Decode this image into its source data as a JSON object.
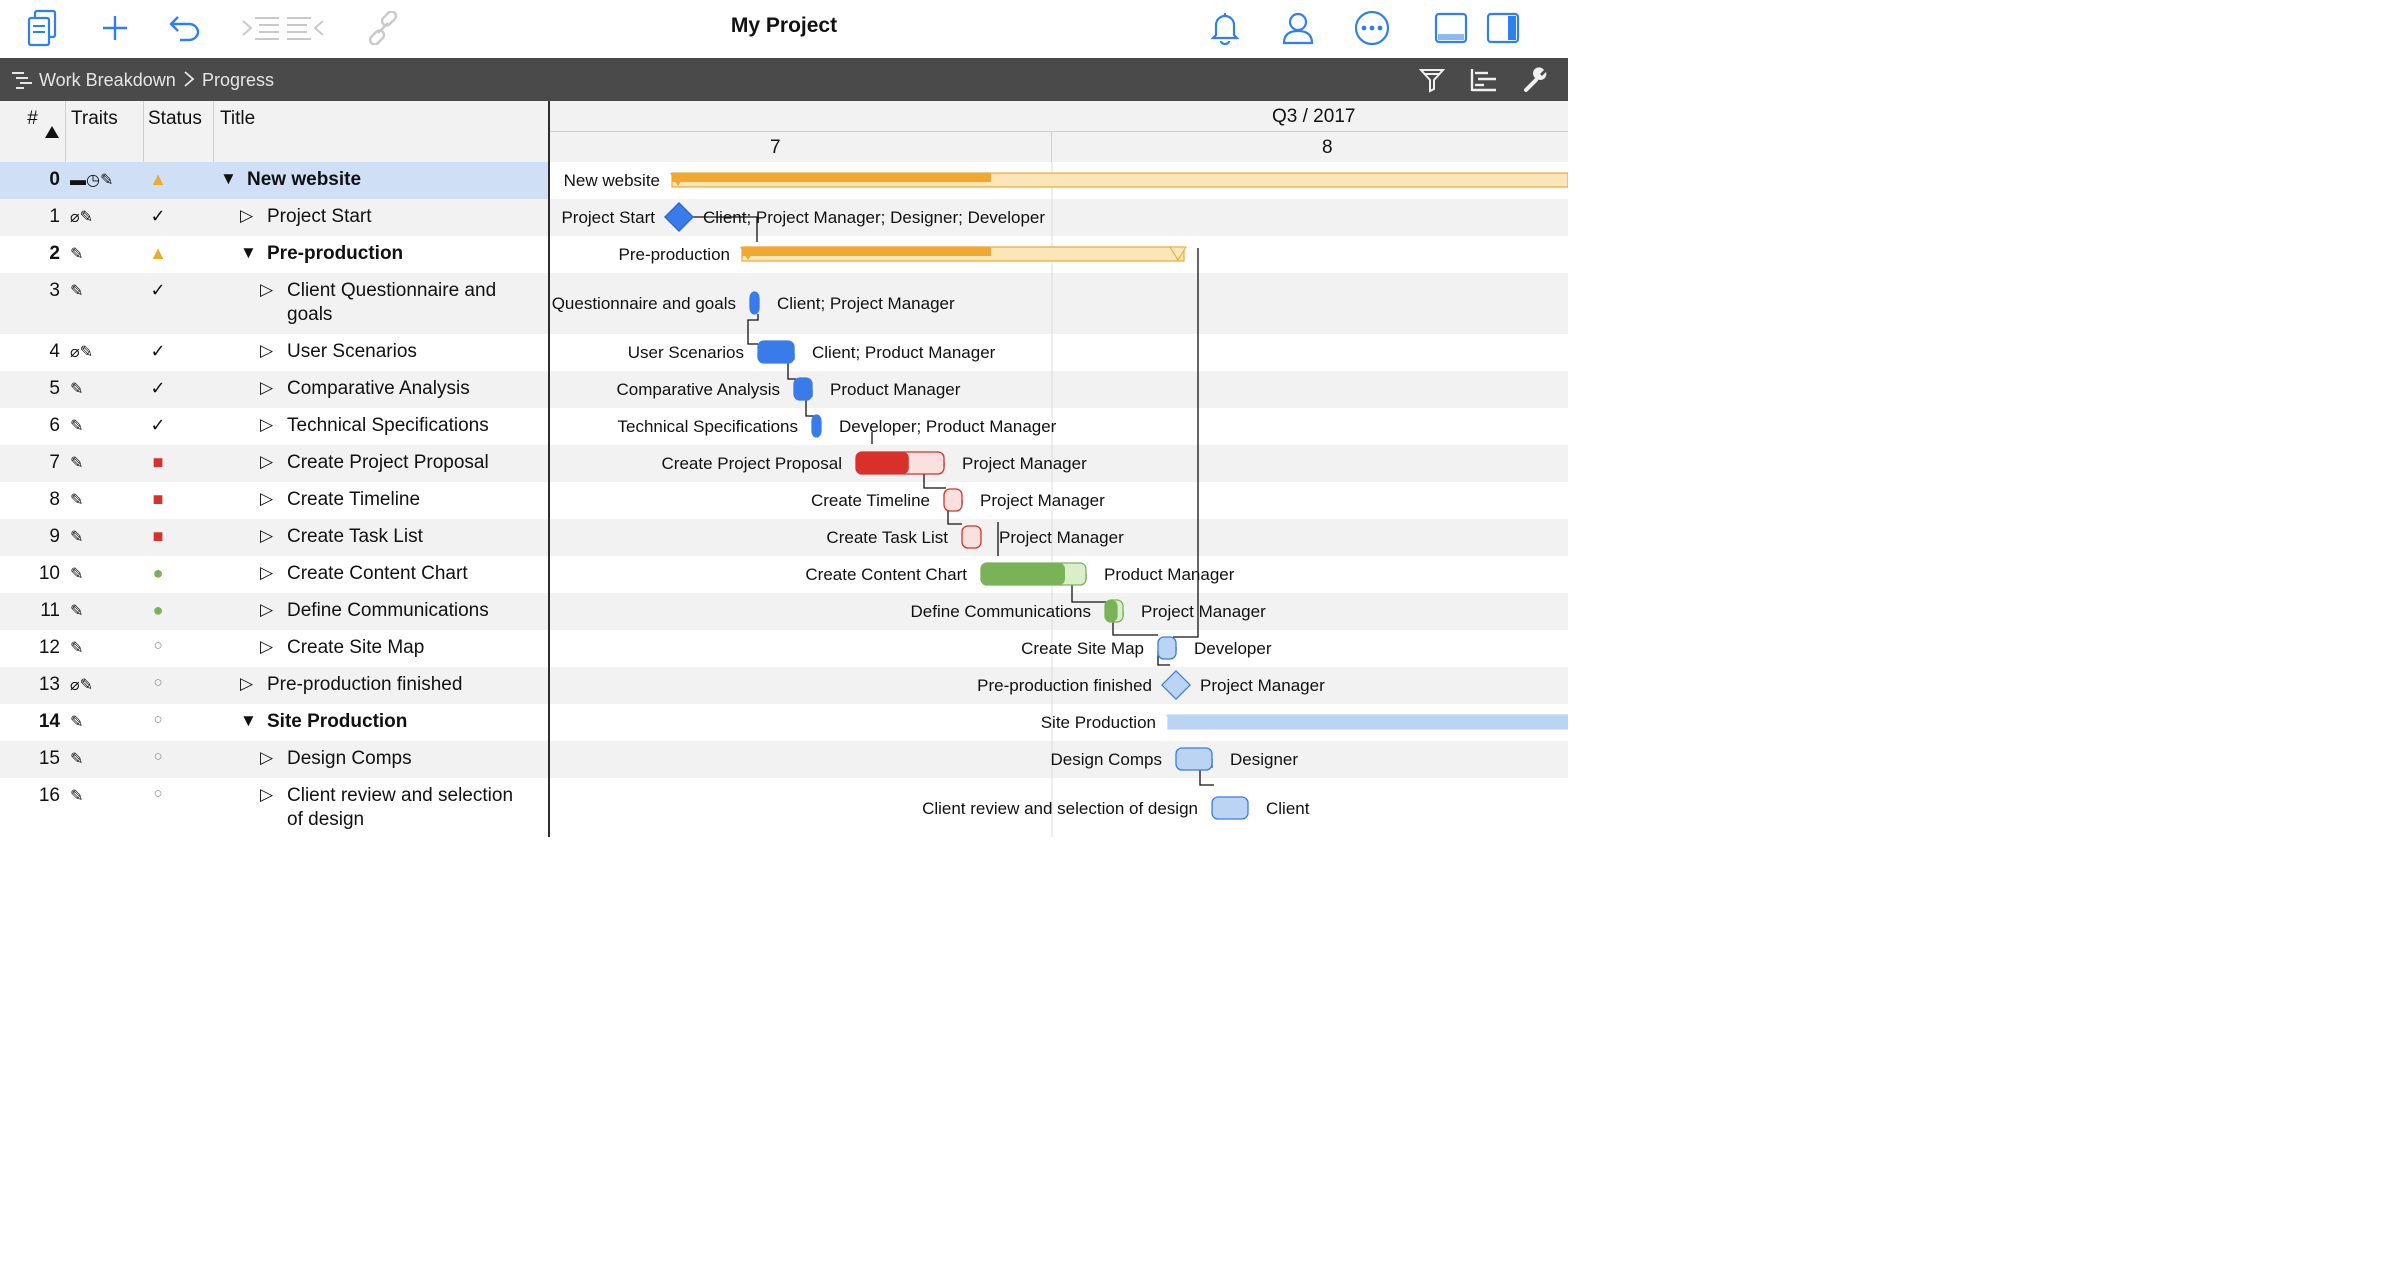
{
  "app": {
    "title": "My Project"
  },
  "breadcrumb": {
    "item1": "Work Breakdown",
    "item2": "Progress"
  },
  "columns": {
    "num": "#",
    "traits": "Traits",
    "status": "Status",
    "title": "Title"
  },
  "timeline": {
    "quarter": "Q3 / 2017",
    "weeks": [
      "7",
      "8"
    ]
  },
  "colors": {
    "complete_blue": "#3a7bec",
    "planned_blue": "#bcd4f4",
    "overdue_red": "#d8302a",
    "ontrack_green": "#7ab357",
    "group_orange": "#f0a830"
  },
  "rows": [
    {
      "num": "0",
      "traits": "▬◷✎",
      "status": "▲",
      "title": "New website",
      "indent": 0,
      "expander": "▼",
      "bold": true,
      "gantt_label": "New website",
      "resources": ""
    },
    {
      "num": "1",
      "traits": "⌀✎",
      "status": "✓",
      "title": "Project Start",
      "indent": 1,
      "expander": "▷",
      "bold": false,
      "gantt_label": "Project Start",
      "resources": "Client; Project Manager; Designer; Developer"
    },
    {
      "num": "2",
      "traits": "✎",
      "status": "▲",
      "title": "Pre-production",
      "indent": 1,
      "expander": "▼",
      "bold": true,
      "gantt_label": "Pre-production",
      "resources": ""
    },
    {
      "num": "3",
      "traits": "✎",
      "status": "✓",
      "title": "Client Questionnaire and",
      "title2": "goals",
      "indent": 2,
      "expander": "▷",
      "bold": false,
      "gantt_label": "Questionnaire and goals",
      "resources": "Client; Project Manager"
    },
    {
      "num": "4",
      "traits": "⌀✎",
      "status": "✓",
      "title": "User Scenarios",
      "indent": 2,
      "expander": "▷",
      "bold": false,
      "gantt_label": "User Scenarios",
      "resources": "Client; Product Manager"
    },
    {
      "num": "5",
      "traits": "✎",
      "status": "✓",
      "title": "Comparative Analysis",
      "indent": 2,
      "expander": "▷",
      "bold": false,
      "gantt_label": "Comparative Analysis",
      "resources": "Product Manager"
    },
    {
      "num": "6",
      "traits": "✎",
      "status": "✓",
      "title": "Technical Specifications",
      "indent": 2,
      "expander": "▷",
      "bold": false,
      "gantt_label": "Technical Specifications",
      "resources": "Developer; Product Manager"
    },
    {
      "num": "7",
      "traits": "✎",
      "status": "■",
      "title": "Create Project Proposal",
      "indent": 2,
      "expander": "▷",
      "bold": false,
      "gantt_label": "Create Project Proposal",
      "resources": "Project Manager"
    },
    {
      "num": "8",
      "traits": "✎",
      "status": "■",
      "title": "Create Timeline",
      "indent": 2,
      "expander": "▷",
      "bold": false,
      "gantt_label": "Create Timeline",
      "resources": "Project Manager"
    },
    {
      "num": "9",
      "traits": "✎",
      "status": "■",
      "title": "Create Task List",
      "indent": 2,
      "expander": "▷",
      "bold": false,
      "gantt_label": "Create Task List",
      "resources": "Project Manager"
    },
    {
      "num": "10",
      "traits": "✎",
      "status": "●",
      "title": "Create Content Chart",
      "indent": 2,
      "expander": "▷",
      "bold": false,
      "gantt_label": "Create Content Chart",
      "resources": "Product Manager"
    },
    {
      "num": "11",
      "traits": "✎",
      "status": "●",
      "title": "Define Communications",
      "indent": 2,
      "expander": "▷",
      "bold": false,
      "gantt_label": "Define Communications",
      "resources": "Project Manager"
    },
    {
      "num": "12",
      "traits": "✎",
      "status": "○",
      "title": "Create Site Map",
      "indent": 2,
      "expander": "▷",
      "bold": false,
      "gantt_label": "Create Site Map",
      "resources": "Developer"
    },
    {
      "num": "13",
      "traits": "⌀✎",
      "status": "○",
      "title": "Pre-production finished",
      "indent": 1,
      "expander": "▷",
      "bold": false,
      "gantt_label": "Pre-production finished",
      "resources": "Project Manager"
    },
    {
      "num": "14",
      "traits": "✎",
      "status": "○",
      "title": "Site Production",
      "indent": 1,
      "expander": "▼",
      "bold": true,
      "gantt_label": "Site Production",
      "resources": ""
    },
    {
      "num": "15",
      "traits": "✎",
      "status": "○",
      "title": "Design Comps",
      "indent": 2,
      "expander": "▷",
      "bold": false,
      "gantt_label": "Design Comps",
      "resources": "Designer"
    },
    {
      "num": "16",
      "traits": "✎",
      "status": "○",
      "title": "Client review and selection",
      "title2": "of design",
      "indent": 2,
      "expander": "▷",
      "bold": false,
      "gantt_label": "Client review and selection of design",
      "resources": "Client"
    }
  ]
}
